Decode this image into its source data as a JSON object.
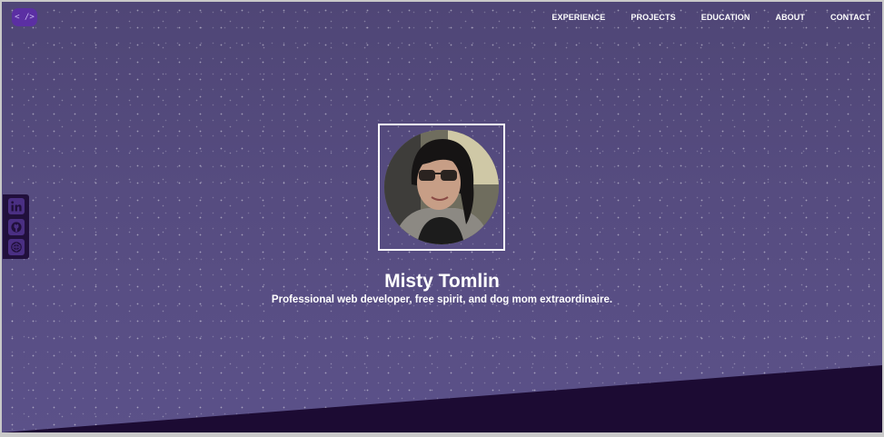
{
  "header": {
    "logo_text": "< />",
    "nav": [
      {
        "label": "EXPERIENCE",
        "id": "experience"
      },
      {
        "label": "PROJECTS",
        "id": "projects"
      },
      {
        "label": "EDUCATION",
        "id": "education"
      },
      {
        "label": "ABOUT",
        "id": "about"
      },
      {
        "label": "CONTACT",
        "id": "contact"
      }
    ]
  },
  "social": {
    "icons": [
      "linkedin-icon",
      "github-icon",
      "codepen-icon"
    ]
  },
  "hero": {
    "name": "Misty Tomlin",
    "tagline": "Professional web developer, free spirit, and dog mom extraordinaire.",
    "avatar_alt": "profile-photo"
  },
  "colors": {
    "background": "#564c80",
    "accent": "#5b2fa3",
    "footer_band": "#1c0b33",
    "text": "#ffffff"
  }
}
